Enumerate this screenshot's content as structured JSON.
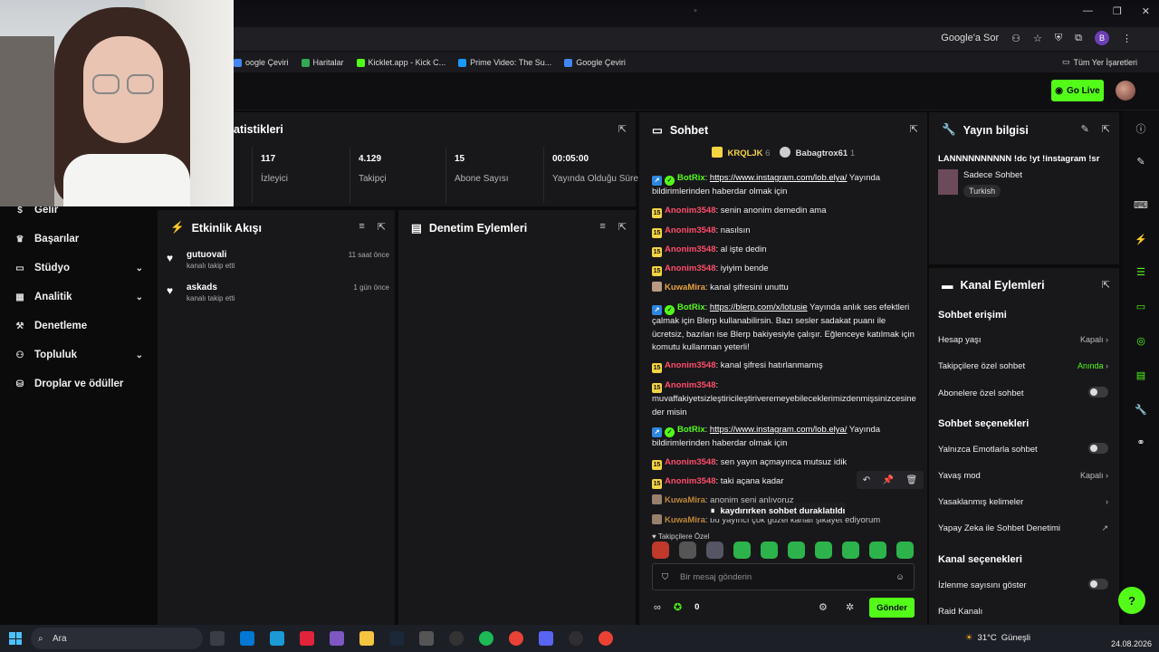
{
  "browser": {
    "google_ask": "Google'a Sor",
    "bookmarks": [
      {
        "label": "oogle Çeviri",
        "color": "#4285f4"
      },
      {
        "label": "Haritalar",
        "color": "#34a853"
      },
      {
        "label": "Kicklet.app - Kick C...",
        "color": "#53fc18"
      },
      {
        "label": "Prime Video: The Su...",
        "color": "#1a98ff"
      },
      {
        "label": "Google Çeviri",
        "color": "#4285f4"
      }
    ],
    "all_bookmarks": "Tüm Yer İşaretleri",
    "profile_letter": "B"
  },
  "header": {
    "go_live": "Go Live"
  },
  "sidebar": {
    "items": [
      {
        "label": "Gelir",
        "icon": "dollar-icon"
      },
      {
        "label": "Başarılar",
        "icon": "trophy-icon"
      },
      {
        "label": "Stüdyo",
        "icon": "studio-icon",
        "chevron": true
      },
      {
        "label": "Analitik",
        "icon": "chart-icon",
        "chevron": true
      },
      {
        "label": "Denetleme",
        "icon": "hammer-icon"
      },
      {
        "label": "Topluluk",
        "icon": "community-icon",
        "chevron": true
      },
      {
        "label": "Droplar ve ödüller",
        "icon": "gift-icon"
      }
    ]
  },
  "stats": {
    "title": "atistikleri",
    "items": [
      {
        "value": "117",
        "label": "İzleyici"
      },
      {
        "value": "4.129",
        "label": "Takipçi"
      },
      {
        "value": "15",
        "label": "Abone Sayısı"
      },
      {
        "value": "00:05:00",
        "label": "Yayında Olduğu Süre"
      }
    ]
  },
  "activity": {
    "title": "Etkinlik Akışı",
    "items": [
      {
        "name": "gutuovali",
        "sub": "kanalı takip etti",
        "time": "11 saat önce"
      },
      {
        "name": "askads",
        "sub": "kanalı takip etti",
        "time": "1 gün önce"
      }
    ]
  },
  "moderation": {
    "title": "Denetim Eylemleri"
  },
  "chat": {
    "title": "Sohbet",
    "pinned": [
      {
        "name": "KRQLJK",
        "count": "6"
      },
      {
        "name": "Babagtrox61",
        "count": "1"
      }
    ],
    "messages": [
      {
        "user": "BotRix",
        "type": "bot",
        "link": "https://www.instagram.com/lob.elya/",
        "text": " Yayında bildirimlerinden haberdar olmak için"
      },
      {
        "user": "Anonim3548",
        "type": "anon",
        "text": "senin anonim demedin ama"
      },
      {
        "user": "Anonim3548",
        "type": "anon",
        "text": "nasılsın"
      },
      {
        "user": "Anonim3548",
        "type": "anon",
        "text": "al işte dedin"
      },
      {
        "user": "Anonim3548",
        "type": "anon",
        "text": "iyiyim bende"
      },
      {
        "user": "KuwaMira",
        "type": "kuwa",
        "text": "kanal şifresini unuttu"
      },
      {
        "user": "BotRix",
        "type": "bot",
        "link": "https://blerp.com/x/lotusie",
        "text": " Yayında anlık ses efektleri çalmak için Blerp kullanabilirsin. Bazı sesler sadakat puanı ile ücretsiz, bazıları ise Blerp bakiyesiyle çalışır. Eğlenceye katılmak için komutu kullanman yeterli!"
      },
      {
        "user": "Anonim3548",
        "type": "anon",
        "text": "kanal şifresi hatırlanmamış"
      },
      {
        "user": "Anonim3548",
        "type": "anon",
        "text": "muvaffakiyetsizleştiricileştiriveremeyebileceklerimizdenmişsinizcesine der misin"
      },
      {
        "user": "BotRix",
        "type": "bot",
        "link": "https://www.instagram.com/lob.elya/",
        "text": " Yayında bildirimlerinden haberdar olmak için"
      },
      {
        "user": "Anonim3548",
        "type": "anon",
        "text": "sen yayın açmayınca mutsuz idik"
      },
      {
        "user": "Anonim3548",
        "type": "anon",
        "text": "taki açana kadar"
      },
      {
        "user": "KuwaMira",
        "type": "kuwa",
        "text": "anonim seni anlıyoruz"
      },
      {
        "user": "KuwaMira",
        "type": "kuwa",
        "text": "bu yayıncı çok güzel kanalı şikayet ediyorum"
      }
    ],
    "paused": "kaydırırken sohbet duraklatıldı",
    "followers_only": "Takipçilere Özel",
    "placeholder": "Bir mesaj gönderin",
    "points": "0",
    "send": "Gönder"
  },
  "stream_info": {
    "title": "Yayın bilgisi",
    "stream_title": "LANNNNNNNNNN !dc !yt !instagram !sr",
    "category": "Sadece Sohbet",
    "tag": "Turkish"
  },
  "channel_actions": {
    "title": "Kanal Eylemleri",
    "chat_access": "Sohbet erişimi",
    "account_age": "Hesap yaşı",
    "account_age_val": "Kapalı",
    "followers_only": "Takipçilere özel sohbet",
    "followers_only_val": "Anında",
    "subs_only": "Abonelere özel sohbet",
    "chat_options": "Sohbet seçenekleri",
    "emote_only": "Yalnızca Emotlarla sohbet",
    "slow_mode": "Yavaş mod",
    "slow_mode_val": "Kapalı",
    "banned_words": "Yasaklanmış kelimeler",
    "ai_mod": "Yapay Zeka ile Sohbet Denetimi",
    "channel_options": "Kanal seçenekleri",
    "show_viewcount": "İzlenme sayısını göster",
    "raid": "Raid Kanalı"
  },
  "taskbar": {
    "search": "Ara",
    "weather": "31°C",
    "weather_text": "Güneşli",
    "date": "24.08.2026"
  },
  "colors": {
    "accent": "#53fc18",
    "panel": "#18181b",
    "anon": "#ff4d6a"
  }
}
